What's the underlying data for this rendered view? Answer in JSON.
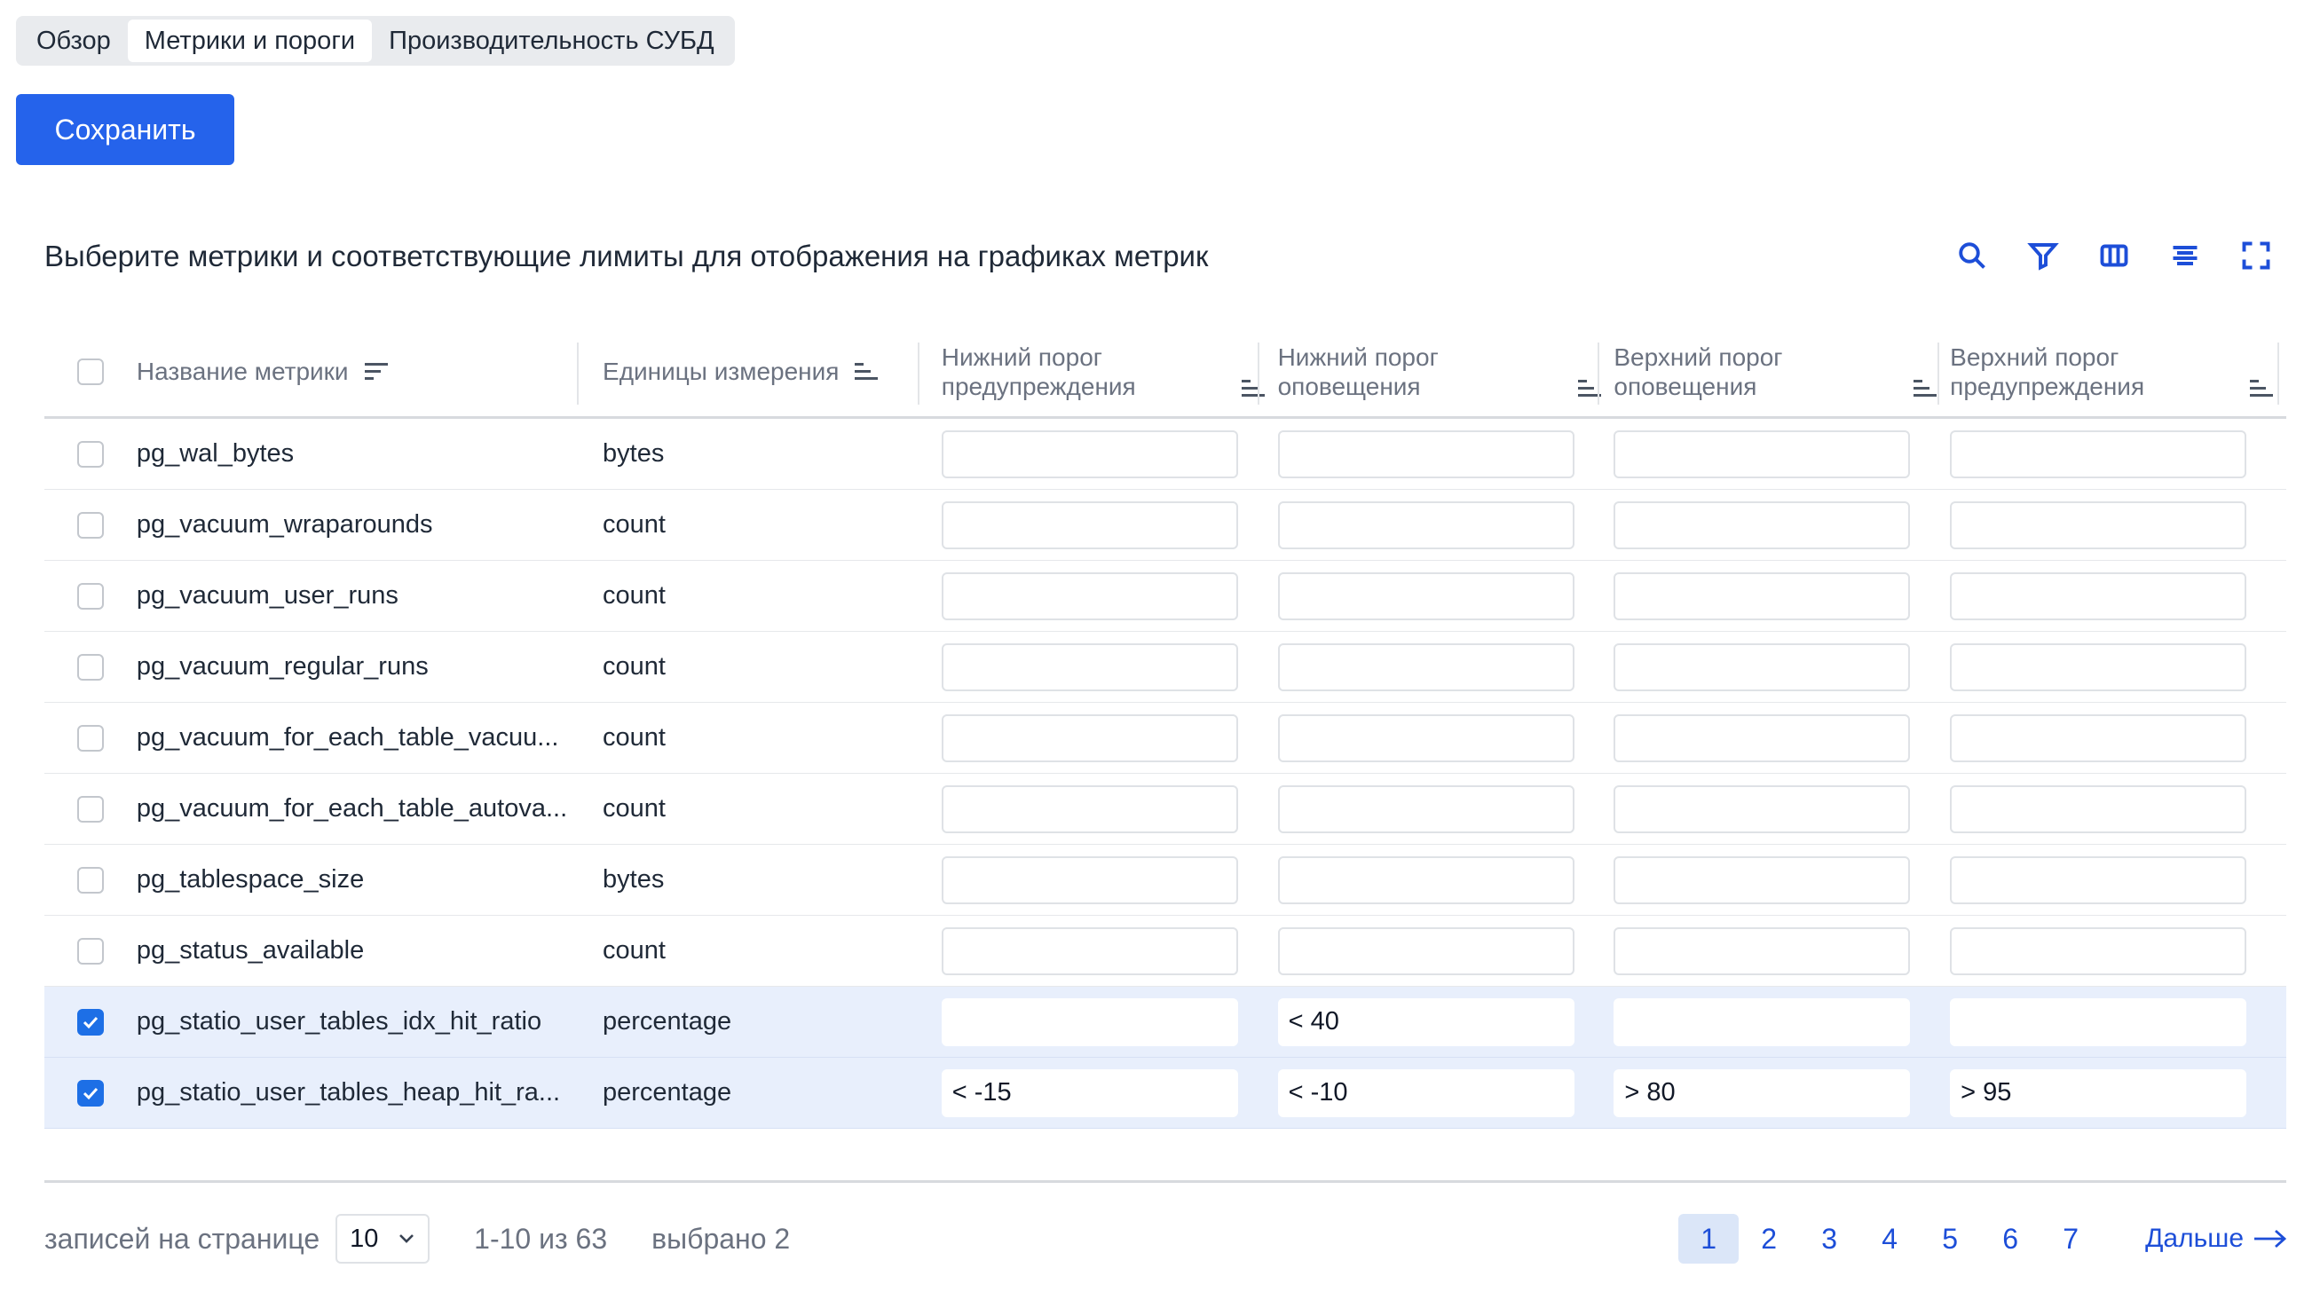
{
  "tabs": [
    {
      "label": "Обзор",
      "active": false
    },
    {
      "label": "Метрики и пороги",
      "active": true
    },
    {
      "label": "Производительность СУБД",
      "active": false
    }
  ],
  "save_label": "Сохранить",
  "headline": "Выберите метрики и соответствующие лимиты для отображения на графиках метрик",
  "toolbar_icons": [
    "search-icon",
    "filter-icon",
    "columns-icon",
    "align-icon",
    "fullscreen-icon"
  ],
  "columns": {
    "name": "Название метрики",
    "unit": "Единицы измерения",
    "low_warning": "Нижний порог предупреждения",
    "low_alert": "Нижний порог оповещения",
    "high_alert": "Верхний порог оповещения",
    "high_warning": "Верхний порог предупреждения"
  },
  "rows": [
    {
      "name": "pg_wal_bytes",
      "unit": "bytes",
      "selected": false,
      "low_warning": "",
      "low_alert": "",
      "high_alert": "",
      "high_warning": ""
    },
    {
      "name": "pg_vacuum_wraparounds",
      "unit": "count",
      "selected": false,
      "low_warning": "",
      "low_alert": "",
      "high_alert": "",
      "high_warning": ""
    },
    {
      "name": "pg_vacuum_user_runs",
      "unit": "count",
      "selected": false,
      "low_warning": "",
      "low_alert": "",
      "high_alert": "",
      "high_warning": ""
    },
    {
      "name": "pg_vacuum_regular_runs",
      "unit": "count",
      "selected": false,
      "low_warning": "",
      "low_alert": "",
      "high_alert": "",
      "high_warning": ""
    },
    {
      "name": "pg_vacuum_for_each_table_vacuu...",
      "unit": "count",
      "selected": false,
      "low_warning": "",
      "low_alert": "",
      "high_alert": "",
      "high_warning": ""
    },
    {
      "name": "pg_vacuum_for_each_table_autova...",
      "unit": "count",
      "selected": false,
      "low_warning": "",
      "low_alert": "",
      "high_alert": "",
      "high_warning": ""
    },
    {
      "name": "pg_tablespace_size",
      "unit": "bytes",
      "selected": false,
      "low_warning": "",
      "low_alert": "",
      "high_alert": "",
      "high_warning": ""
    },
    {
      "name": "pg_status_available",
      "unit": "count",
      "selected": false,
      "low_warning": "",
      "low_alert": "",
      "high_alert": "",
      "high_warning": ""
    },
    {
      "name": "pg_statio_user_tables_idx_hit_ratio",
      "unit": "percentage",
      "selected": true,
      "low_warning": "",
      "low_alert": "< 40",
      "high_alert": "",
      "high_warning": ""
    },
    {
      "name": "pg_statio_user_tables_heap_hit_ra...",
      "unit": "percentage",
      "selected": true,
      "low_warning": "< -15",
      "low_alert": "< -10",
      "high_alert": "> 80",
      "high_warning": "> 95"
    }
  ],
  "footer": {
    "per_page_label": "записей на странице",
    "per_page_value": "10",
    "range": "1-10 из 63",
    "selected": "выбрано 2"
  },
  "pagination": {
    "pages": [
      "1",
      "2",
      "3",
      "4",
      "5",
      "6",
      "7"
    ],
    "current": "1",
    "next_label": "Дальше"
  },
  "colors": {
    "accent": "#2563eb",
    "selected_row": "#e8effc",
    "link": "#1d4ed8"
  }
}
